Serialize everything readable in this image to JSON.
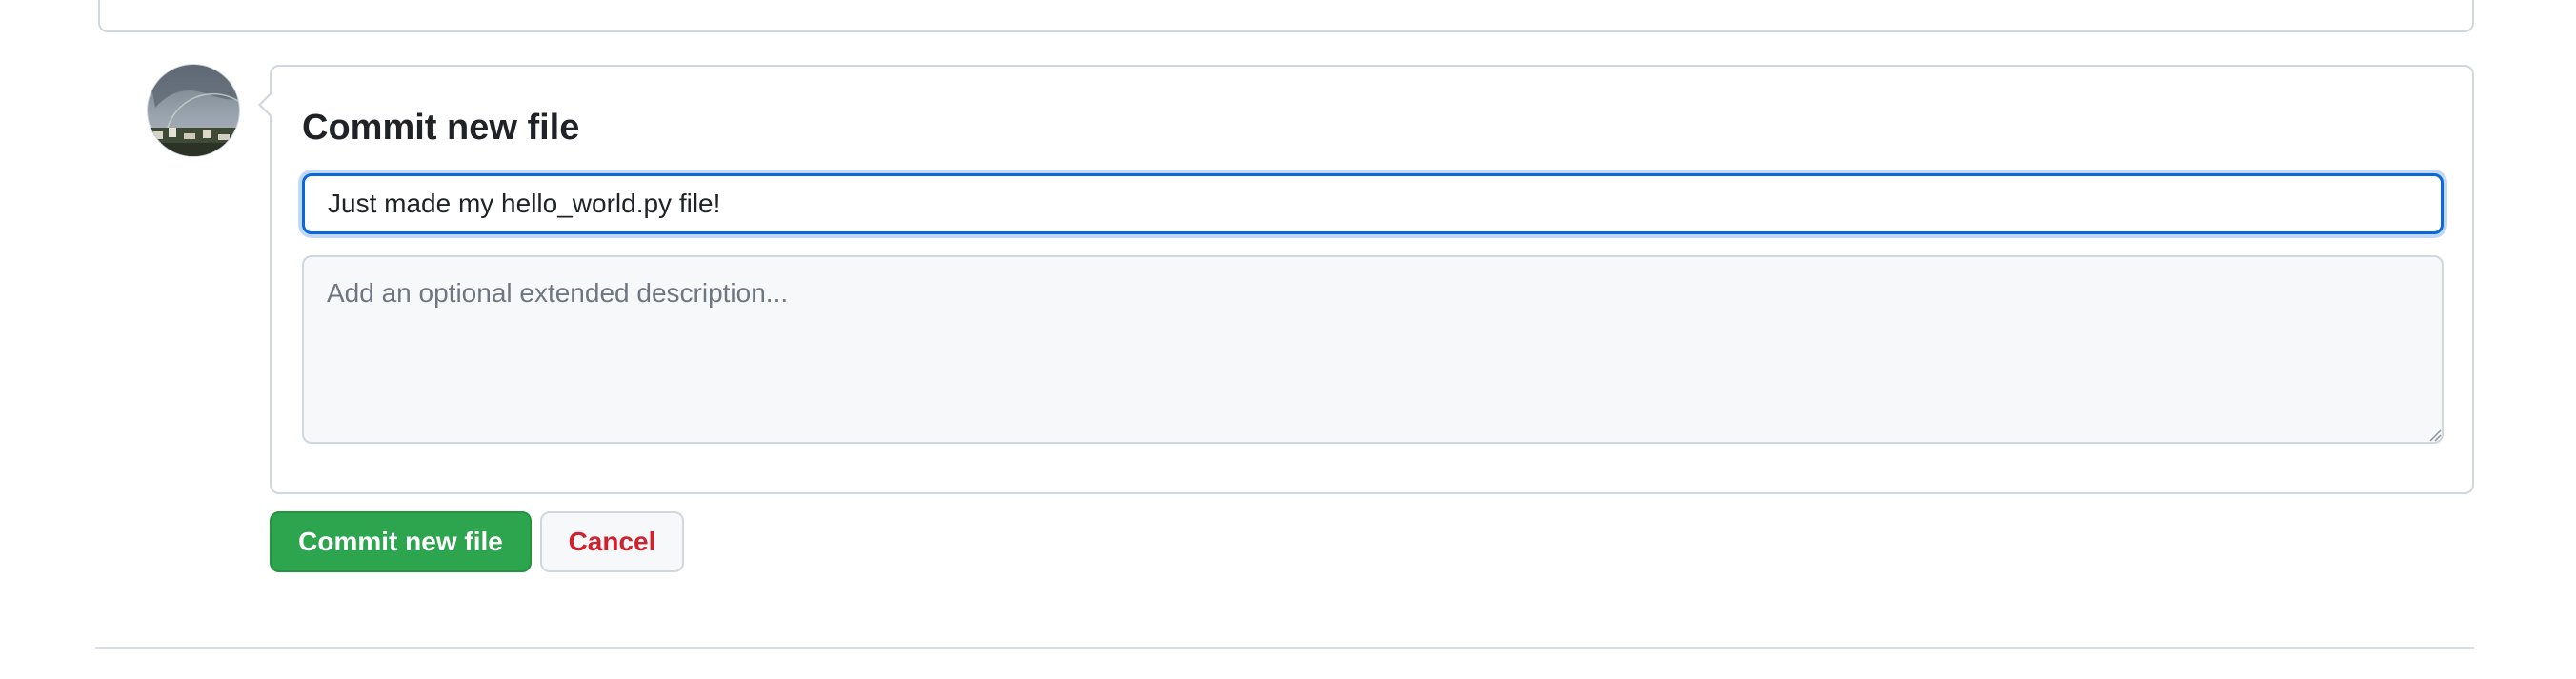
{
  "commit": {
    "heading": "Commit new file",
    "summary_value": "Just made my hello_world.py file!",
    "description_placeholder": "Add an optional extended description..."
  },
  "actions": {
    "commit_label": "Commit new file",
    "cancel_label": "Cancel"
  },
  "colors": {
    "primary_button": "#2da44e",
    "cancel_text": "#cf222e",
    "focus_ring": "#0969da"
  },
  "icons": {
    "avatar": "user-avatar",
    "resize": "resize-grip-icon"
  }
}
